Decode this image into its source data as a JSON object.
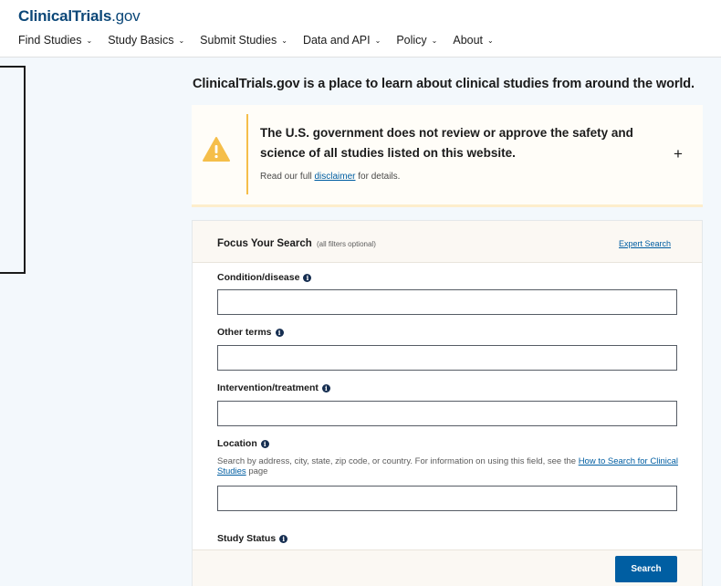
{
  "header": {
    "logo_main": "ClinicalTrials",
    "logo_suffix": ".gov",
    "nav": [
      {
        "label": "Find Studies"
      },
      {
        "label": "Study Basics"
      },
      {
        "label": "Submit Studies"
      },
      {
        "label": "Data and API"
      },
      {
        "label": "Policy"
      },
      {
        "label": "About"
      }
    ]
  },
  "main": {
    "headline": "ClinicalTrials.gov is a place to learn about clinical studies from around the world."
  },
  "alert": {
    "icon": "warning-icon",
    "title": "The U.S. government does not review or approve the safety and science of all studies listed on this website.",
    "text_before": "Read our full ",
    "link": "disclaimer",
    "text_after": " for details.",
    "expand_symbol": "+"
  },
  "search": {
    "title": "Focus Your Search",
    "optional_note": "(all filters optional)",
    "expert_link": "Expert Search",
    "fields": [
      {
        "label": "Condition/disease",
        "value": "",
        "placeholder": ""
      },
      {
        "label": "Other terms",
        "value": "",
        "placeholder": ""
      },
      {
        "label": "Intervention/treatment",
        "value": "",
        "placeholder": ""
      },
      {
        "label": "Location",
        "value": "",
        "placeholder": ""
      }
    ],
    "location_hint_before": "Search by address, city, state, zip code, or country. For information on using this field, see the ",
    "location_hint_link": "How to Search for Clinical Studies",
    "location_hint_after": " page",
    "status_label": "Study Status",
    "search_button": "Search"
  },
  "colors": {
    "brand": "#0b4778",
    "link": "#005ea2",
    "warning": "#f5be4a",
    "button": "#005ea2",
    "page_bg": "#f3f8fc"
  }
}
